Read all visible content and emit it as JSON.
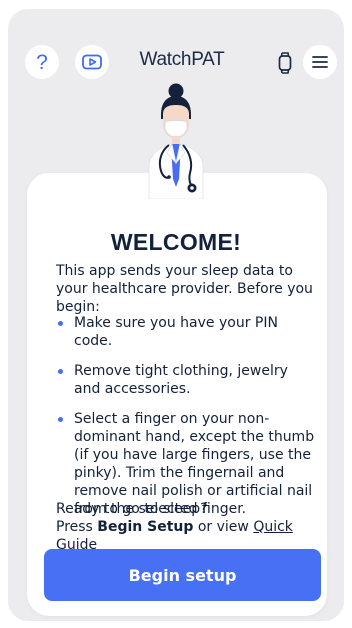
{
  "header": {
    "help_glyph": "?",
    "help_icon": "question-mark-icon",
    "video_icon": "play-video-icon",
    "logo_watch": "Watch",
    "logo_pat": "PAT",
    "watch_icon": "smartwatch-icon",
    "menu_icon": "hamburger-menu-icon"
  },
  "welcome": {
    "title": "WELCOME!",
    "intro": "This app sends your sleep data to your healthcare provider. Before you begin:",
    "bullets": [
      "Make sure you have your PIN code.",
      "Remove tight clothing, jewelry and accessories.",
      "Select a finger on your non-dominant hand, except the thumb (if you have large fingers, use the pinky). Trim the fingernail and remove nail polish or artificial nail from the selected finger."
    ],
    "ready_line1": "Ready to go to sleep?",
    "ready_press": "Press ",
    "ready_bold": "Begin Setup",
    "ready_or": " or view ",
    "ready_link": "Quick Guide"
  },
  "actions": {
    "begin_label": "Begin setup"
  },
  "colors": {
    "accent": "#4770f5",
    "background": "#ececef",
    "text": "#13213a",
    "doctor_coat": "#4a6cf0"
  },
  "illustration": "doctor-with-stethoscope"
}
